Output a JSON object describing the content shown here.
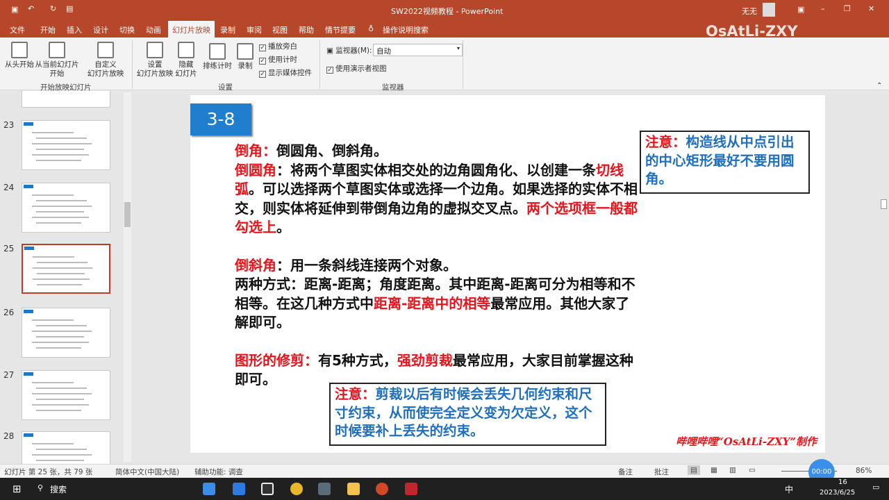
{
  "window": {
    "title": "SW2022视频教程 - PowerPoint",
    "user": "无无",
    "watermark": "OsAtLi-ZXY"
  },
  "tabs": [
    "文件",
    "开始",
    "插入",
    "设计",
    "切换",
    "动画",
    "幻灯片放映",
    "录制",
    "审阅",
    "视图",
    "帮助",
    "情节提要"
  ],
  "active_tab": "幻灯片放映",
  "search_label": "操作说明搜索",
  "ribbon": {
    "from_start": "从头开始",
    "from_current_1": "从当前幻灯片",
    "from_current_2": "开始",
    "custom_1": "自定义",
    "custom_2": "幻灯片放映",
    "group_start": "开始放映幻灯片",
    "setup_1": "设置",
    "setup_2": "幻灯片放映",
    "hide_1": "隐藏",
    "hide_2": "幻灯片",
    "rehearse": "排练计时",
    "record": "录制",
    "chk_narration": "播放旁白",
    "chk_timing": "使用计时",
    "chk_media": "显示媒体控件",
    "group_setup": "设置",
    "monitor_label": "监视器(M):",
    "monitor_value": "自动",
    "chk_presenter": "使用演示者视图",
    "group_monitor": "监视器"
  },
  "thumbnails": [
    {
      "num": "23"
    },
    {
      "num": "24"
    },
    {
      "num": "25",
      "selected": true
    },
    {
      "num": "26"
    },
    {
      "num": "27"
    },
    {
      "num": "28"
    }
  ],
  "slide": {
    "badge": "3-8",
    "paragraphs": [
      [
        {
          "t": "倒角：",
          "red": true
        },
        {
          "t": "倒圆角、倒斜角。"
        }
      ],
      [
        {
          "t": "倒圆角",
          "red": true
        },
        {
          "t": "：将两个草图实体相交处的边角圆角化、以创建一条"
        },
        {
          "t": "切线弧",
          "red": true
        },
        {
          "t": "。可以选择两个草图实体或选择一个边角。如果选择的实体不相交，则实体将延伸到带倒角边角的虚拟交叉点。"
        },
        {
          "t": "两个选项框一般都勾选上",
          "red": true
        },
        {
          "t": "。"
        }
      ],
      [],
      [
        {
          "t": "倒斜角",
          "red": true
        },
        {
          "t": "：用一条斜线连接两个对象。"
        }
      ],
      [
        {
          "t": "两种方式：距离-距离；角度距离。其中距离-距离可分为相等和不相等。在这几种方式中"
        },
        {
          "t": "距离-距离中的相等",
          "red": true
        },
        {
          "t": "最常应用。其他大家了解即可。"
        }
      ],
      [],
      [
        {
          "t": "图形的修剪：",
          "red": true
        },
        {
          "t": "有5种方式，"
        },
        {
          "t": "强劲剪裁",
          "red": true
        },
        {
          "t": "最常应用，大家目前掌握这种即可。"
        }
      ]
    ],
    "note1": {
      "label": "注意：",
      "text": "构造线从中点引出的中心矩形最好不要用圆角。"
    },
    "note2": {
      "label": "注意：",
      "text": "剪裁以后有时候会丢失几何约束和尺寸约束，从而使完全定义变为欠定义，这个时候要补上丢失的约束。"
    },
    "signature": "哔哩哔哩“OsAtLi-ZXY”制作"
  },
  "status": {
    "slide_info": "幻灯片 第 25 张，共 79 张",
    "language": "简体中文(中国大陆)",
    "accessibility": "辅助功能: 调查",
    "notes": "备注",
    "comments": "批注",
    "zoom": "86%",
    "timer": "00:00"
  },
  "taskbar": {
    "search": "搜索",
    "ime": "中",
    "time": "16",
    "date": "2023/6/25"
  },
  "colors": {
    "accent": "#b7472a",
    "red_text": "#e8141b",
    "blue_text": "#1f6fc0",
    "badge": "#1f7fce"
  }
}
